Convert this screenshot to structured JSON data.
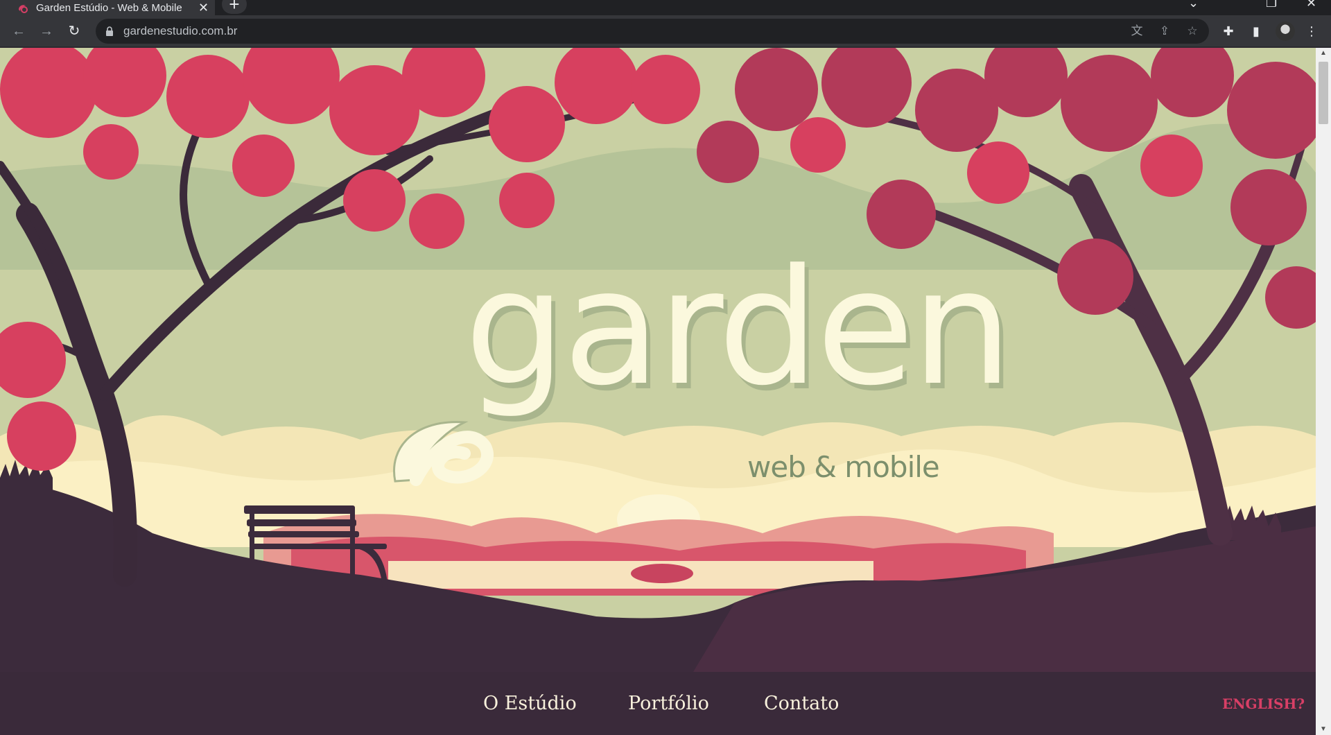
{
  "browser": {
    "tab_title": "Garden Estúdio - Web & Mobile",
    "url": "gardenestudio.com.br",
    "icons": {
      "back": "arrow-left-icon",
      "forward": "arrow-right-icon",
      "reload": "reload-icon",
      "lock": "lock-icon",
      "translate": "translate-icon",
      "share": "share-icon",
      "bookmark": "star-icon",
      "extensions": "puzzle-icon",
      "sidepanel": "side-panel-icon",
      "menu": "kebab-menu-icon"
    }
  },
  "hero": {
    "logo_main": "garden",
    "logo_sub": "web & mobile"
  },
  "nav": {
    "items": [
      {
        "label": "O Estúdio"
      },
      {
        "label": "Portfólio"
      },
      {
        "label": "Contato"
      }
    ],
    "lang": "ENGLISH?"
  },
  "colors": {
    "sky": "#c9d0a3",
    "foliage": "#d7405f",
    "foliage_dark": "#b23a59",
    "trunk": "#3b2a3a",
    "ground": "#3c2b3c",
    "cream": "#fbf8dd",
    "accent": "#d83f66"
  }
}
